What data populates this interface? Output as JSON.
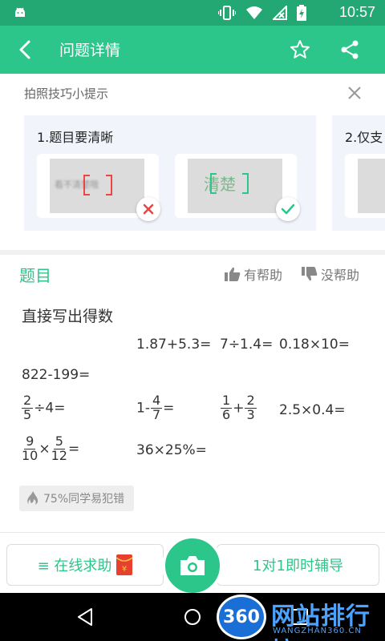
{
  "status_bar": {
    "time": "10:57"
  },
  "app_bar": {
    "title": "问题详情"
  },
  "tips": {
    "title": "拍照技巧小提示",
    "cards": [
      {
        "label": "1.题目要清晰",
        "bad_sample_text": "看不清楚哦",
        "good_sample_text": "清楚"
      },
      {
        "label": "2.仅支"
      }
    ]
  },
  "question": {
    "heading": "题目",
    "helpful_label": "有帮助",
    "unhelpful_label": "没帮助",
    "title": "直接写出得数",
    "line1": [
      "1.87+5.3=",
      "7÷1.4=",
      "0.18×10="
    ],
    "line2": "822-199=",
    "frac1": {
      "num": "2",
      "den": "5",
      "tail": "÷4="
    },
    "frac2": {
      "prefix": "1-",
      "num": "4",
      "den": "7",
      "tail": "="
    },
    "frac3": {
      "num1": "1",
      "den1": "6",
      "op": "+",
      "num2": "2",
      "den2": "3"
    },
    "expr_plain": "2.5×0.4=",
    "frac4": {
      "num1": "9",
      "den1": "10",
      "op": "×",
      "num2": "5",
      "den2": "12",
      "tail": "="
    },
    "expr_percent": "36×25%=",
    "error_hint": "75%同学易犯错"
  },
  "bottom": {
    "left_button": "≡ 在线求助",
    "right_button": "1对1即时辅导"
  },
  "watermark": {
    "badge": "360",
    "text": "网站排行榜",
    "url": "WANGZHAN360.CN"
  },
  "colors": {
    "primary": "#2cc68a",
    "status_bar": "#23a873"
  }
}
